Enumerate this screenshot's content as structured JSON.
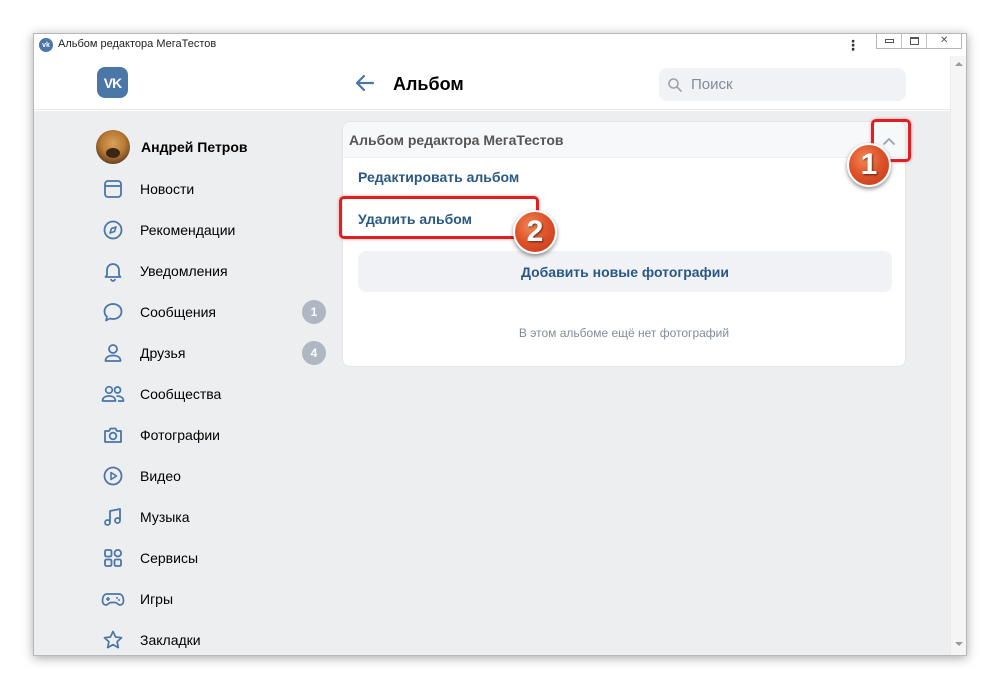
{
  "window": {
    "title": "Альбом редактора МегаТестов",
    "menu_glyph": "⋮",
    "close_glyph": "✕"
  },
  "header": {
    "logo_text": "VK",
    "page_title": "Альбом",
    "search_placeholder": "Поиск"
  },
  "sidebar": {
    "profile_name": "Андрей Петров",
    "items": [
      {
        "label": "Новости",
        "icon": "news-icon"
      },
      {
        "label": "Рекомендации",
        "icon": "compass-icon"
      },
      {
        "label": "Уведомления",
        "icon": "bell-icon"
      },
      {
        "label": "Сообщения",
        "icon": "message-icon",
        "badge": "1"
      },
      {
        "label": "Друзья",
        "icon": "user-icon",
        "badge": "4"
      },
      {
        "label": "Сообщества",
        "icon": "users-icon"
      },
      {
        "label": "Фотографии",
        "icon": "camera-icon"
      },
      {
        "label": "Видео",
        "icon": "play-icon"
      },
      {
        "label": "Музыка",
        "icon": "music-icon"
      },
      {
        "label": "Сервисы",
        "icon": "grid-icon"
      },
      {
        "label": "Игры",
        "icon": "gamepad-icon"
      },
      {
        "label": "Закладки",
        "icon": "star-icon"
      }
    ]
  },
  "album": {
    "title": "Альбом редактора МегаТестов",
    "edit_link": "Редактировать альбом",
    "delete_link": "Удалить альбом",
    "add_button": "Добавить новые фотографии",
    "empty_note": "В этом альбоме ещё нет фотографий"
  },
  "annotations": {
    "step1": "1",
    "step2": "2"
  },
  "colors": {
    "accent": "#4a76a8",
    "link": "#2a5885",
    "background": "#edeef0",
    "highlight": "#e02020",
    "marker": "#e0542a"
  }
}
